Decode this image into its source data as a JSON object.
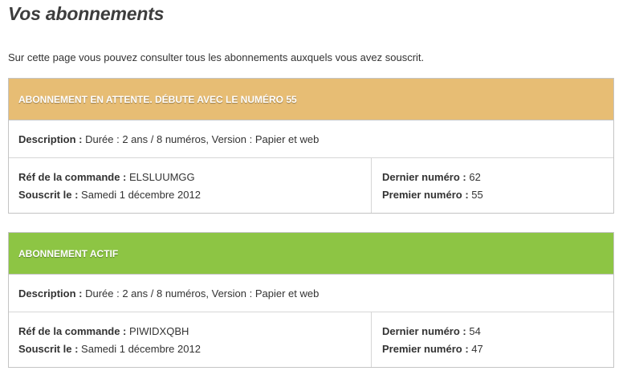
{
  "page": {
    "title": "Vos abonnements",
    "intro": "Sur cette page vous pouvez consulter tous les abonnements auxquels vous avez souscrit."
  },
  "subscriptions": [
    {
      "status": "ABONNEMENT EN ATTENTE. DÉBUTE AVEC LE NUMÉRO 55",
      "status_color": "#e7bd74",
      "description_label": "Description :",
      "description_value": "Durée : 2 ans / 8 numéros, Version : Papier et web",
      "order_ref_label": "Réf de la commande :",
      "order_ref_value": "ELSLUUMGG",
      "subscribed_label": "Souscrit le :",
      "subscribed_value": "Samedi 1 décembre 2012",
      "last_issue_label": "Dernier numéro :",
      "last_issue_value": "62",
      "first_issue_label": "Premier numéro :",
      "first_issue_value": "55"
    },
    {
      "status": "ABONNEMENT ACTIF",
      "status_color": "#8dc544",
      "description_label": "Description :",
      "description_value": "Durée : 2 ans / 8 numéros, Version : Papier et web",
      "order_ref_label": "Réf de la commande :",
      "order_ref_value": "PIWIDXQBH",
      "subscribed_label": "Souscrit le :",
      "subscribed_value": "Samedi 1 décembre 2012",
      "last_issue_label": "Dernier numéro :",
      "last_issue_value": "54",
      "first_issue_label": "Premier numéro :",
      "first_issue_value": "47"
    }
  ]
}
